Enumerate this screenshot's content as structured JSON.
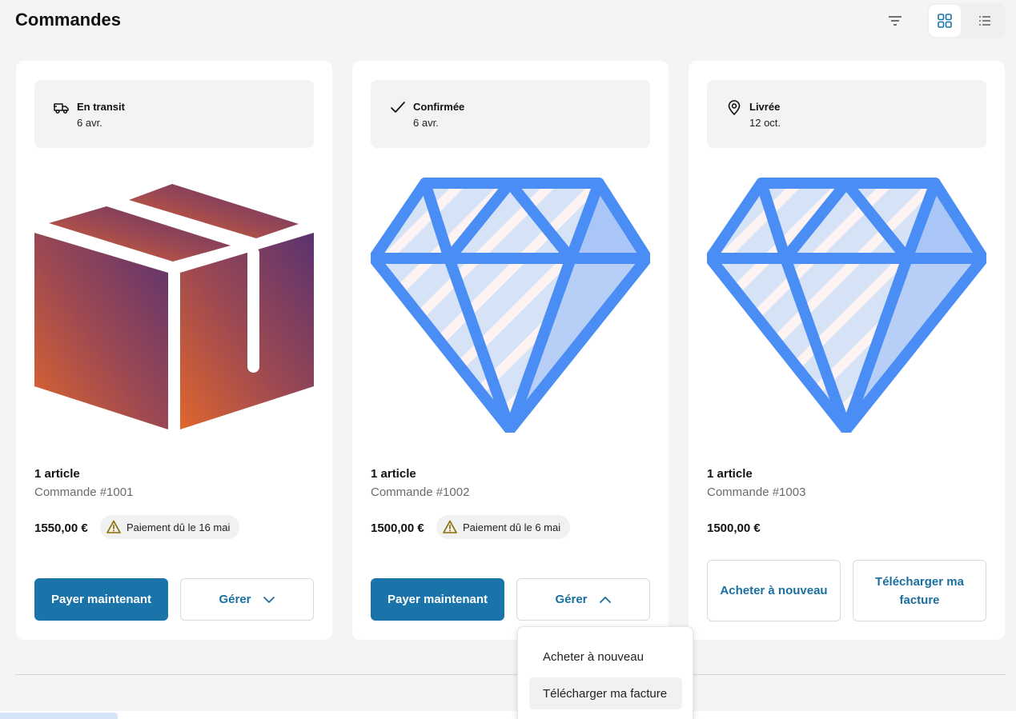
{
  "page": {
    "title": "Commandes"
  },
  "toolbar": {
    "filter_icon": "filter-icon",
    "grid_view_icon": "grid-view-icon",
    "list_view_icon": "list-view-icon",
    "active_view": "grid"
  },
  "orders": [
    {
      "status": "En transit",
      "status_icon": "truck-icon",
      "date": "6 avr.",
      "image": "box-icon",
      "items": "1 article",
      "order_number": "Commande #1001",
      "price": "1550,00 €",
      "payment_notice": "Paiement dû le 16 mai",
      "primary_action": "Payer maintenant",
      "secondary_action": "Gérer",
      "manage_open": false
    },
    {
      "status": "Confirmée",
      "status_icon": "check-icon",
      "date": "6 avr.",
      "image": "diamond-icon",
      "items": "1 article",
      "order_number": "Commande #1002",
      "price": "1500,00 €",
      "payment_notice": "Paiement dû le 6 mai",
      "primary_action": "Payer maintenant",
      "secondary_action": "Gérer",
      "manage_open": true
    },
    {
      "status": "Livrée",
      "status_icon": "location-pin-icon",
      "date": "12 oct.",
      "image": "diamond-icon",
      "items": "1 article",
      "order_number": "Commande #1003",
      "price": "1500,00 €",
      "buy_again": "Acheter à nouveau",
      "download_invoice": "Télécharger ma facture"
    }
  ],
  "manage_menu": {
    "items": [
      "Acheter à nouveau",
      "Télécharger ma facture"
    ],
    "hovered": "Télécharger ma facture"
  },
  "colors": {
    "primary": "#1a73a9",
    "link": "#1a6fa0",
    "diamond_stroke": "#4a8ef5",
    "diamond_fill": "#d6e2f6",
    "warning": "#8a6a00"
  }
}
